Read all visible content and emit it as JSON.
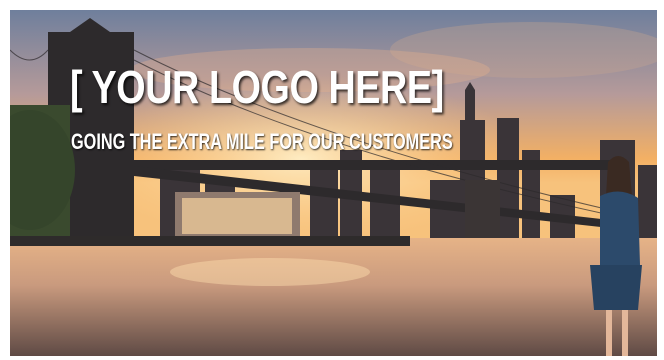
{
  "slide": {
    "logo_placeholder": "[ YOUR LOGO HERE]",
    "tagline": "GOING THE EXTRA MILE FOR OUR CUSTOMERS"
  },
  "colors": {
    "sky_top": "#6f7f9c",
    "sky_glow": "#f3b064",
    "water": "#c99a7e",
    "dress": "#2c4a6b"
  }
}
